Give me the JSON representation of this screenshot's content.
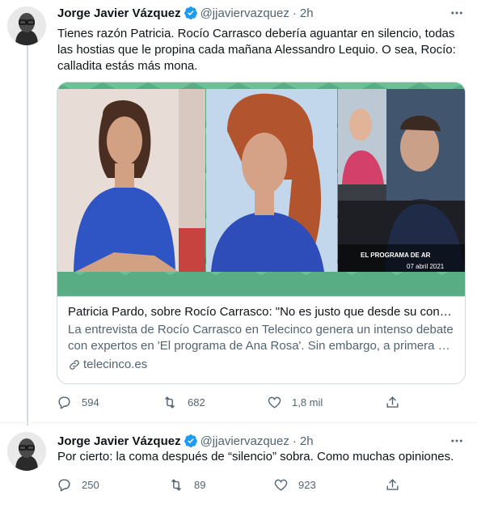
{
  "colors": {
    "verified": "#1d9bf0",
    "text": "#0f1419",
    "secondary": "#536471",
    "border": "#cfd9de",
    "card_frame_green": "#4fa37a"
  },
  "tweets": [
    {
      "author_name": "Jorge Javier Vázquez",
      "handle": "@jjaviervazquez",
      "separator": "·",
      "time": "2h",
      "text": "Tienes razón Patricia. Rocío Carrasco debería aguantar en silencio, todas las hostias que le propina cada mañana Alessandro Lequio. O sea, Rocío: calladita estás más mona.",
      "card": {
        "image_caption_title": "EL PROGRAMA DE AR",
        "image_caption_date": "07 abril 2021",
        "title": "Patricia Pardo, sobre Rocío Carrasco: \"No es justo que desde su condici...",
        "description_line1": "La entrevista de Rocío Carrasco en Telecinco genera un intenso debate",
        "description_line2": "con expertos en 'El programa de Ana Rosa'. Sin embargo, a primera en...",
        "domain": "telecinco.es"
      },
      "actions": {
        "replies": "594",
        "retweets": "682",
        "likes": "1,8 mil"
      }
    },
    {
      "author_name": "Jorge Javier Vázquez",
      "handle": "@jjaviervazquez",
      "separator": "·",
      "time": "2h",
      "text": "Por cierto: la coma después de “silencio” sobra. Como muchas opiniones.",
      "actions": {
        "replies": "250",
        "retweets": "89",
        "likes": "923"
      }
    }
  ],
  "icons": {
    "verified": "verified-badge-icon",
    "more": "more-options-icon",
    "reply": "reply-icon",
    "retweet": "retweet-icon",
    "like": "heart-icon",
    "share": "share-icon",
    "link": "link-icon"
  }
}
